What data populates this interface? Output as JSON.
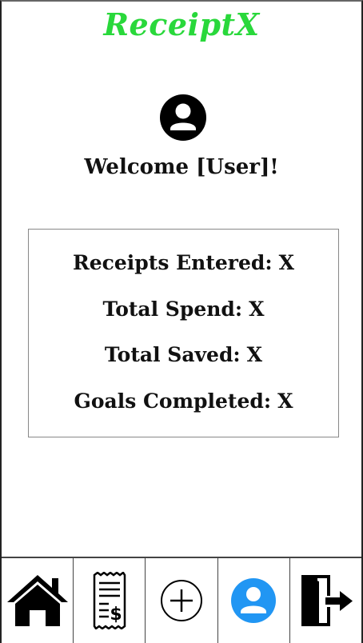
{
  "app": {
    "title": "ReceiptX",
    "brand_color": "#29d83b"
  },
  "profile": {
    "avatar_icon": "user-avatar-icon",
    "welcome_text": "Welcome [User]!"
  },
  "stats": [
    {
      "label": "Receipts Entered:",
      "value": "X"
    },
    {
      "label": "Total Spend:",
      "value": "X"
    },
    {
      "label": "Total Saved:",
      "value": "X"
    },
    {
      "label": "Goals Completed:",
      "value": "X"
    }
  ],
  "tabbar": {
    "tabs": [
      {
        "icon": "home-icon"
      },
      {
        "icon": "receipt-dollar-icon"
      },
      {
        "icon": "add-circle-icon"
      },
      {
        "icon": "profile-icon",
        "active": true,
        "color": "#2196f3"
      },
      {
        "icon": "logout-icon"
      }
    ]
  }
}
